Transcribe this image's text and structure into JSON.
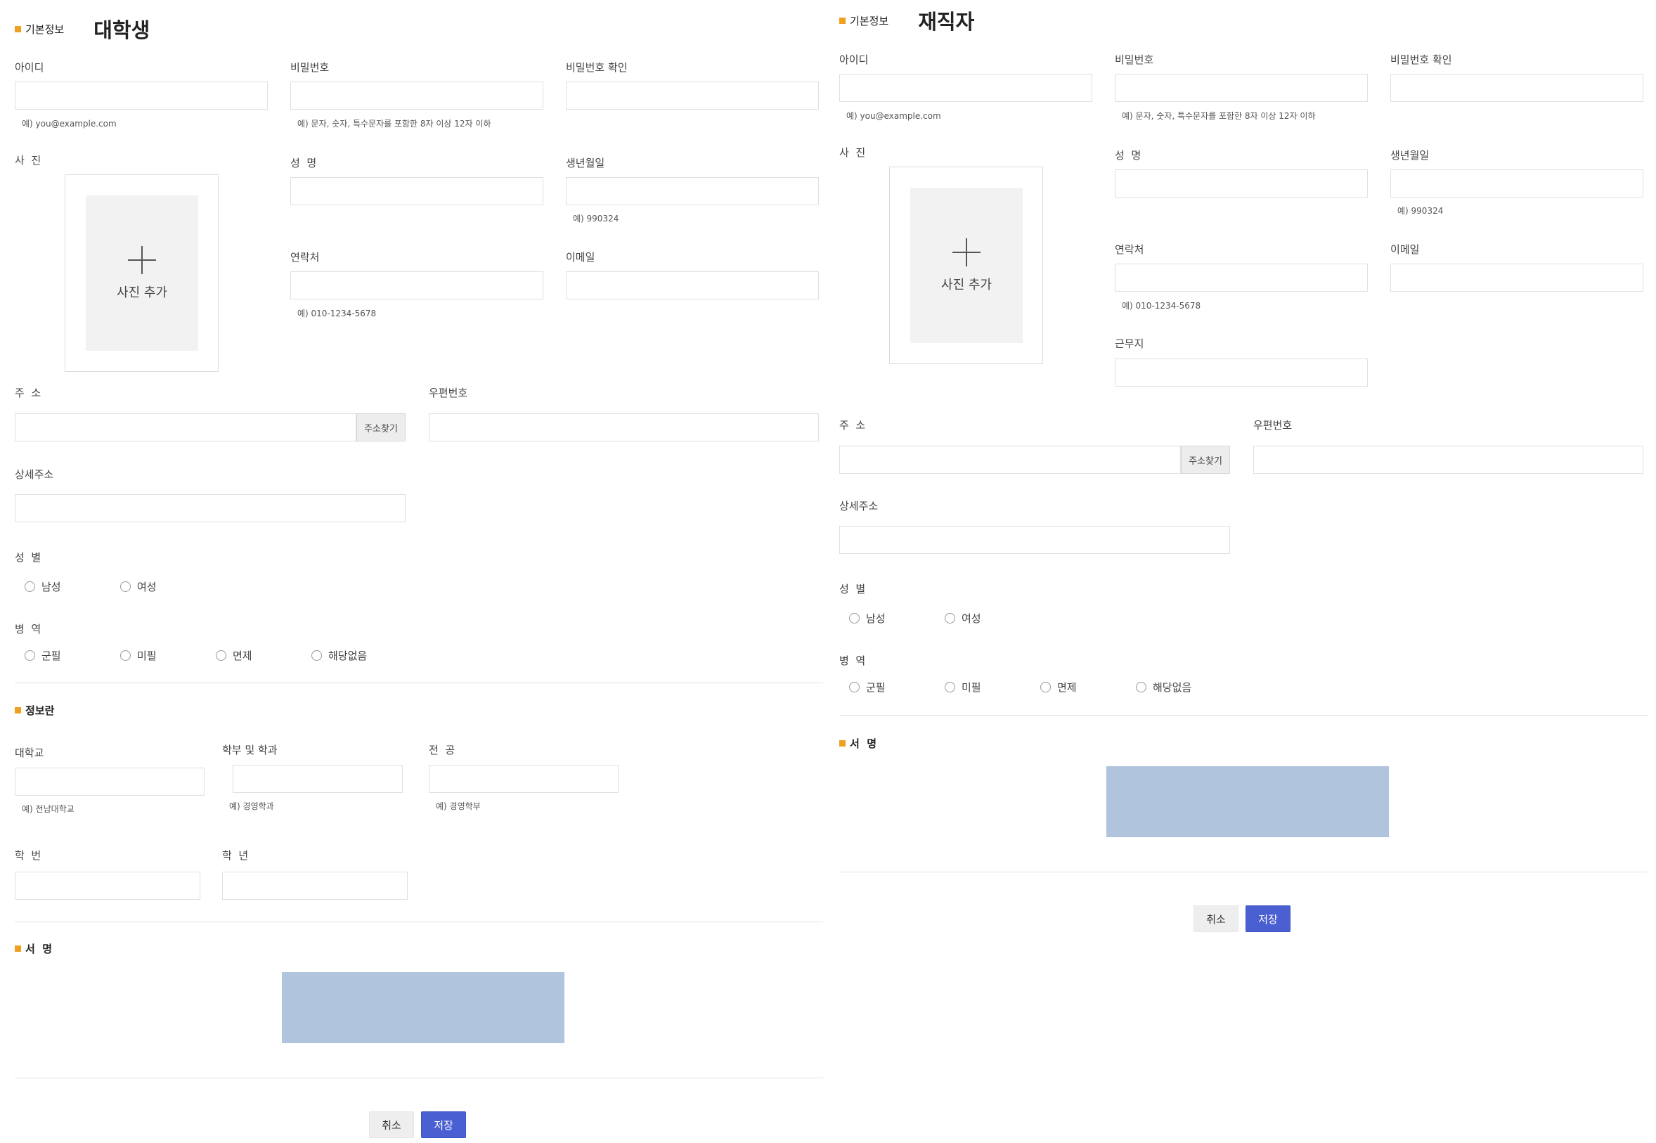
{
  "left": {
    "basic": {
      "section": "기본정보",
      "title": "대학생"
    },
    "fields": {
      "id_label": "아이디",
      "id_hint": "예) you@example.com",
      "pw_label": "비밀번호",
      "pw_hint": "예) 문자, 숫자, 특수문자를 포함한 8자 이상 12자 이하",
      "pw_confirm_label": "비밀번호 확인",
      "photo_label": "사  진",
      "photo_add": "사진 추가",
      "name_label": "성  명",
      "birth_label": "생년월일",
      "birth_hint": "예) 990324",
      "phone_label": "연락처",
      "phone_hint": "예) 010-1234-5678",
      "email_label": "이메일",
      "addr_label": "주  소",
      "addr_button": "주소찾기",
      "zip_label": "우편번호",
      "detail_label": "상세주소",
      "gender_label": "성  별",
      "gender_options": [
        "남성",
        "여성"
      ],
      "military_label": "병  역",
      "military_options": [
        "군필",
        "미필",
        "면제",
        "해당없음"
      ]
    },
    "info": {
      "section": "정보란",
      "univ_label": "대학교",
      "univ_hint": "예) 전남대학교",
      "dept_label": "학부 및 학과",
      "dept_hint": "예) 경영학과",
      "major_label": "전  공",
      "major_hint": "예) 경영학부",
      "student_no_label": "학  번",
      "grade_label": "학  년"
    },
    "signature": {
      "section": "서  명"
    },
    "actions": {
      "cancel": "취소",
      "save": "저장"
    }
  },
  "right": {
    "basic": {
      "section": "기본정보",
      "title": "재직자"
    },
    "fields": {
      "id_label": "아이디",
      "id_hint": "예) you@example.com",
      "pw_label": "비밀번호",
      "pw_hint": "예) 문자, 숫자, 특수문자를 포함한 8자 이상 12자 이하",
      "pw_confirm_label": "비밀번호 확인",
      "photo_label": "사  진",
      "photo_add": "사진 추가",
      "name_label": "성  명",
      "birth_label": "생년월일",
      "birth_hint": "예) 990324",
      "phone_label": "연락처",
      "phone_hint": "예) 010-1234-5678",
      "email_label": "이메일",
      "workplace_label": "근무지",
      "addr_label": "주  소",
      "addr_button": "주소찾기",
      "zip_label": "우편번호",
      "detail_label": "상세주소",
      "gender_label": "성  별",
      "gender_options": [
        "남성",
        "여성"
      ],
      "military_label": "병  역",
      "military_options": [
        "군필",
        "미필",
        "면제",
        "해당없음"
      ]
    },
    "signature": {
      "section": "서  명"
    },
    "actions": {
      "cancel": "취소",
      "save": "저장"
    }
  },
  "colors": {
    "accent_square": "#f0a020",
    "signature_box": "#b0c4de",
    "save_button": "#4a5fd1"
  }
}
